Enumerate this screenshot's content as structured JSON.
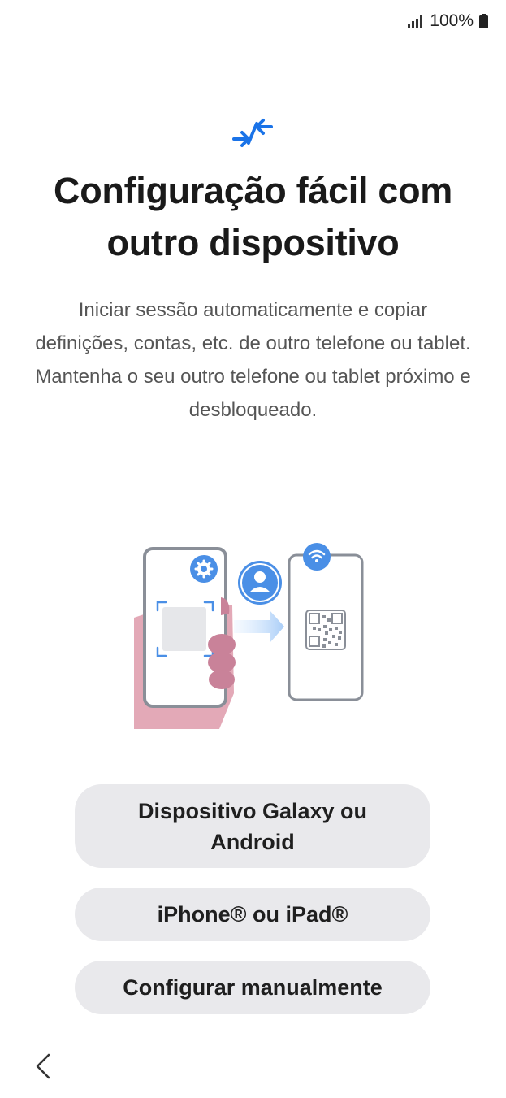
{
  "status_bar": {
    "battery_text": "100%",
    "signal_icon": "signal-bars-icon",
    "battery_icon": "battery-full-icon"
  },
  "header": {
    "icon": "transfer-arrows-icon",
    "title": "Configuração fácil com outro dispositivo"
  },
  "description": "Iniciar sessão automaticamente e copiar definições, contas, etc. de outro telefone ou tablet. Mantenha o seu outro telefone ou tablet próximo e desbloqueado.",
  "illustration": {
    "icons": [
      "phone-in-hand-icon",
      "settings-gear-icon",
      "user-avatar-icon",
      "arrow-right-icon",
      "wifi-icon",
      "qr-code-icon"
    ]
  },
  "buttons": {
    "galaxy_label": "Dispositivo Galaxy ou Android",
    "iphone_label": "iPhone® ou iPad®",
    "manual_label": "Configurar manualmente"
  },
  "nav": {
    "back_icon": "chevron-left-icon"
  },
  "colors": {
    "accent": "#1a73e8",
    "icon_blue": "#4a8fe6",
    "button_bg": "#e9e9ec",
    "hand_pink": "#e3a9b7"
  }
}
